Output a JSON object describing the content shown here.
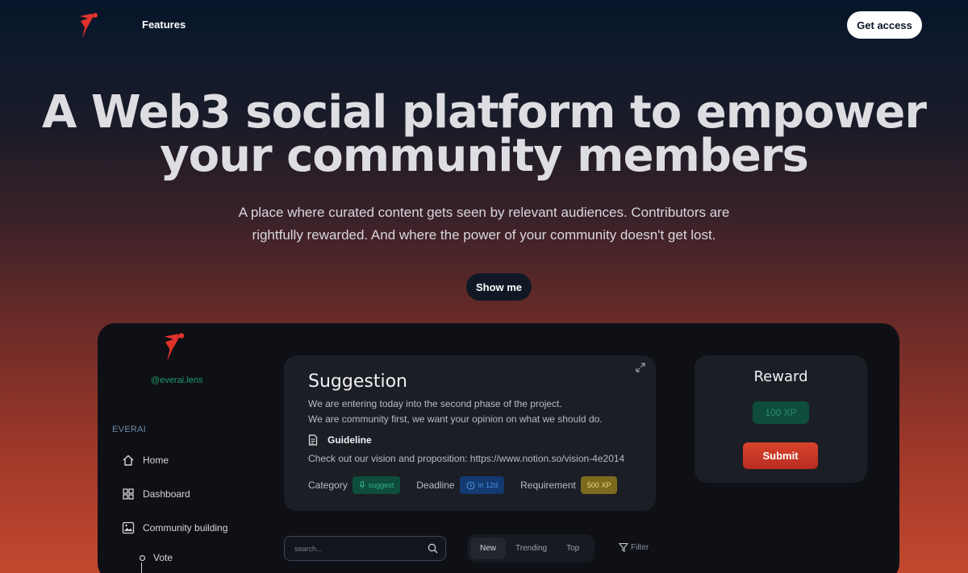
{
  "nav": {
    "links": [
      "Features"
    ],
    "cta": "Get access"
  },
  "hero": {
    "title_line1": "A Web3 social platform to empower",
    "title_line2": "your community members",
    "subtitle": "A place where curated content gets seen by relevant audiences. Contributors are rightfully rewarded. And where the power of your community doesn't get lost.",
    "cta": "Show me"
  },
  "app": {
    "handle": "@everai.lens",
    "brand": "EVERAI",
    "menu": [
      {
        "label": "Home",
        "icon": "home-icon"
      },
      {
        "label": "Dashboard",
        "icon": "grid-icon"
      },
      {
        "label": "Community building",
        "icon": "image-icon"
      }
    ],
    "submenu": [
      "Vote"
    ],
    "suggestion": {
      "title": "Suggestion",
      "line1": "We are entering today into the second phase of the project.",
      "line2": "We are community first, we want your opinion on what we should do.",
      "guideline_label": "Guideline",
      "guideline_text": "Check out our vision and proposition: https://www.notion.so/vision-4e2014",
      "category_label": "Category",
      "category_value": "suggest",
      "deadline_label": "Deadline",
      "deadline_value": "in 12d",
      "requirement_label": "Requirement",
      "requirement_value": "500 XP"
    },
    "reward": {
      "title": "Reward",
      "xp": "100 XP",
      "submit": "Submit"
    },
    "search": {
      "placeholder": "search..."
    },
    "tabs": [
      "New",
      "Trending",
      "Top"
    ],
    "filter": "Filter"
  },
  "colors": {
    "accent_red": "#c8352a",
    "green_pill": "#0e4d3c",
    "blue_pill": "#133a70",
    "gold_pill": "#7c6a1e"
  }
}
